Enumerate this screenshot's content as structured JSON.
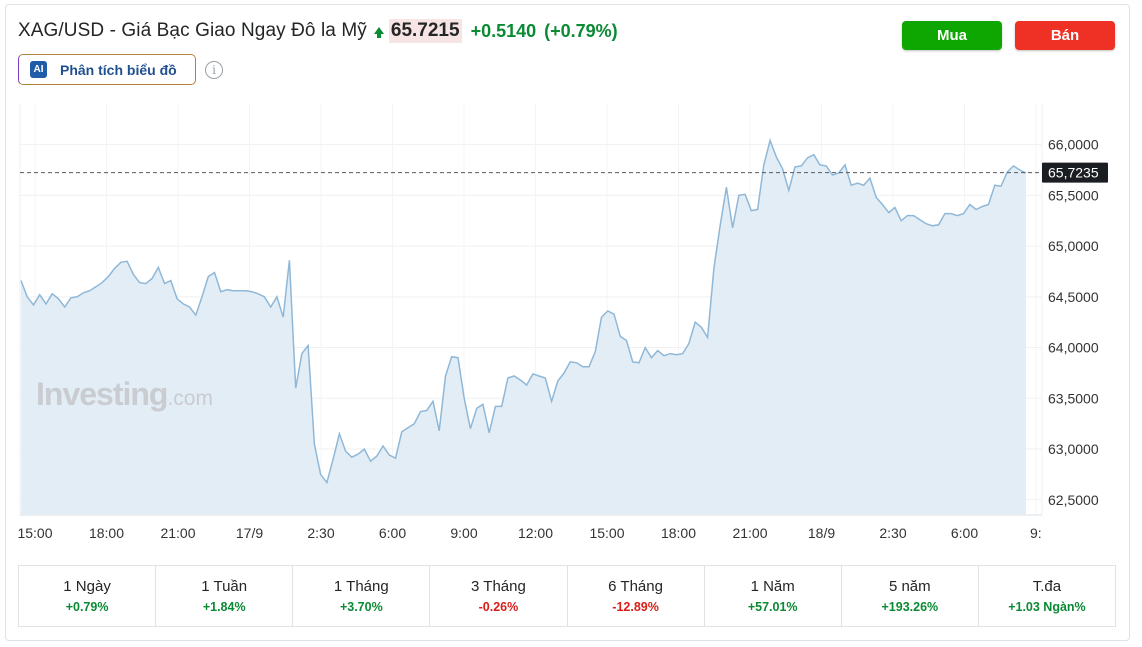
{
  "header": {
    "title": "XAG/USD - Giá Bạc Giao Ngay Đô la Mỹ",
    "price": "65.7215",
    "change": "+0.5140",
    "change_pct": "(+0.79%)"
  },
  "buttons": {
    "buy": "Mua",
    "sell": "Bán"
  },
  "ai": {
    "badge": "AI",
    "label": "Phân tích biểu đồ"
  },
  "info_icon": "i",
  "watermark": {
    "main": "Investing",
    "suffix": ".com"
  },
  "colors": {
    "line": "#8fb8d8",
    "fill": "#e3edf5",
    "up": "#0a8a33",
    "down": "#d91e18",
    "buy": "#0ea600",
    "sell": "#ee3124"
  },
  "chart_data": {
    "type": "area",
    "ylim": [
      62.35,
      66.4
    ],
    "y_ticks": [
      "66,0000",
      "65,5000",
      "65,0000",
      "64,5000",
      "64,0000",
      "63,5000",
      "63,0000",
      "62,5000"
    ],
    "y_tick_values": [
      66.0,
      65.5,
      65.0,
      64.5,
      64.0,
      63.5,
      63.0,
      62.5
    ],
    "x_ticks": [
      "15:00",
      "18:00",
      "21:00",
      "17/9",
      "2:30",
      "6:00",
      "9:00",
      "12:00",
      "15:00",
      "18:00",
      "21:00",
      "18/9",
      "2:30",
      "6:00",
      "9:"
    ],
    "current_label": "65,7235",
    "current_value": 65.7235,
    "values": [
      64.66,
      64.5,
      64.42,
      64.52,
      64.43,
      64.53,
      64.48,
      64.4,
      64.49,
      64.5,
      64.54,
      64.56,
      64.6,
      64.64,
      64.7,
      64.78,
      64.84,
      64.85,
      64.72,
      64.64,
      64.63,
      64.68,
      64.79,
      64.63,
      64.66,
      64.48,
      64.43,
      64.4,
      64.32,
      64.5,
      64.7,
      64.74,
      64.55,
      64.57,
      64.56,
      64.56,
      64.56,
      64.55,
      64.53,
      64.5,
      64.4,
      64.5,
      64.3,
      64.86,
      63.6,
      63.94,
      64.02,
      63.05,
      62.75,
      62.67,
      62.9,
      63.15,
      62.98,
      62.92,
      62.95,
      63.0,
      62.88,
      62.93,
      63.03,
      62.94,
      62.91,
      63.17,
      63.21,
      63.25,
      63.37,
      63.38,
      63.47,
      63.18,
      63.72,
      63.91,
      63.9,
      63.5,
      63.2,
      63.4,
      63.44,
      63.16,
      63.42,
      63.42,
      63.7,
      63.72,
      63.68,
      63.63,
      63.74,
      63.72,
      63.7,
      63.47,
      63.67,
      63.75,
      63.86,
      63.85,
      63.81,
      63.81,
      63.96,
      64.3,
      64.36,
      64.33,
      64.11,
      64.07,
      63.86,
      63.85,
      64.0,
      63.9,
      63.97,
      63.92,
      63.94,
      63.93,
      63.94,
      64.04,
      64.25,
      64.2,
      64.1,
      64.78,
      65.2,
      65.58,
      65.18,
      65.5,
      65.51,
      65.35,
      65.36,
      65.8,
      66.04,
      65.88,
      65.76,
      65.55,
      65.78,
      65.79,
      65.87,
      65.9,
      65.8,
      65.79,
      65.7,
      65.72,
      65.8,
      65.6,
      65.62,
      65.6,
      65.67,
      65.48,
      65.41,
      65.33,
      65.38,
      65.25,
      65.3,
      65.3,
      65.26,
      65.22,
      65.2,
      65.21,
      65.32,
      65.32,
      65.3,
      65.32,
      65.41,
      65.36,
      65.39,
      65.41,
      65.6,
      65.59,
      65.73,
      65.79,
      65.75,
      65.72
    ]
  },
  "periods": [
    {
      "label": "1 Ngày",
      "value": "+0.79%",
      "dir": "up"
    },
    {
      "label": "1 Tuần",
      "value": "+1.84%",
      "dir": "up"
    },
    {
      "label": "1 Tháng",
      "value": "+3.70%",
      "dir": "up"
    },
    {
      "label": "3 Tháng",
      "value": "-0.26%",
      "dir": "down"
    },
    {
      "label": "6 Tháng",
      "value": "-12.89%",
      "dir": "down"
    },
    {
      "label": "1 Năm",
      "value": "+57.01%",
      "dir": "up"
    },
    {
      "label": "5 năm",
      "value": "+193.26%",
      "dir": "up"
    },
    {
      "label": "T.đa",
      "value": "+1.03 Ngàn%",
      "dir": "up"
    }
  ]
}
